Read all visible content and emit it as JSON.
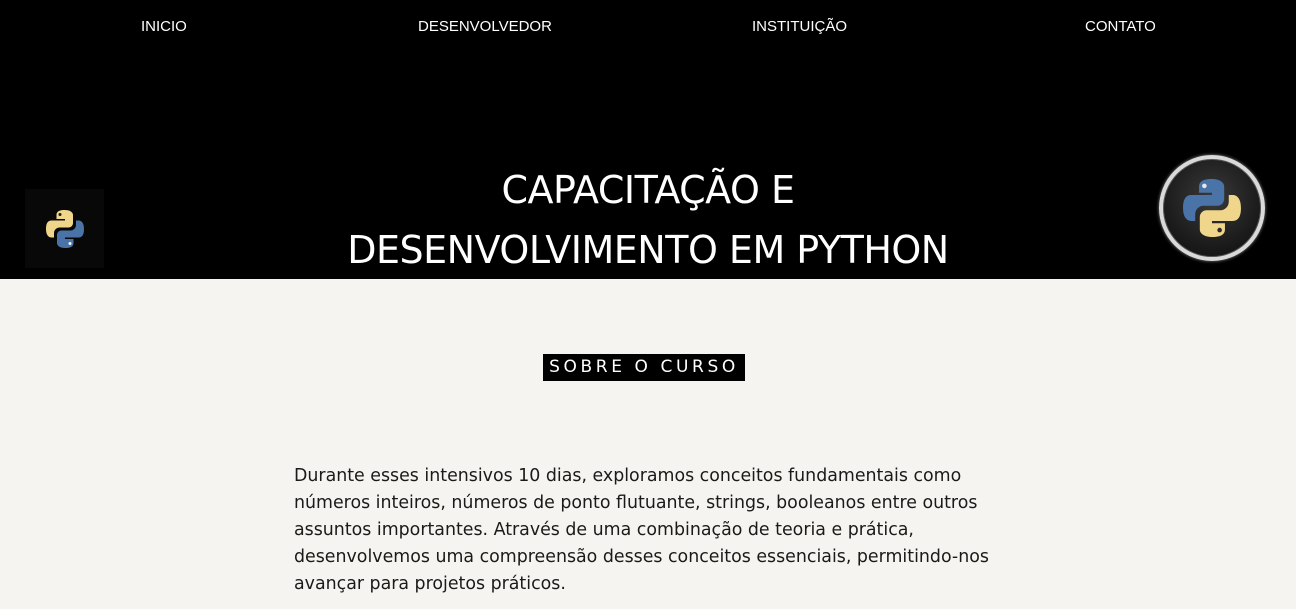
{
  "nav": {
    "items": [
      {
        "label": "INICIO"
      },
      {
        "label": "DESENVOLVEDOR"
      },
      {
        "label": "INSTITUIÇÃO"
      },
      {
        "label": "CONTATO"
      }
    ]
  },
  "hero": {
    "title_line1": "CAPACITAÇÃO E",
    "title_line2": "DESENVOLVIMENTO EM PYTHON",
    "logo_left_icon": "python-logo-icon",
    "logo_right_icon": "python-logo-icon"
  },
  "about": {
    "section_label": "SOBRE O CURSO",
    "paragraph": "Durante esses intensivos 10 dias, exploramos conceitos fundamentais como números inteiros, números de ponto flutuante, strings, booleanos entre outros assuntos importantes. Através de uma combinação de teoria e prática, desenvolvemos uma compreensão desses conceitos essenciais, permitindo-nos avançar para projetos práticos."
  },
  "colors": {
    "header_bg": "#000000",
    "page_bg": "#f5f4f0",
    "python_blue": "#4a74a8",
    "python_yellow": "#f0d68a"
  }
}
